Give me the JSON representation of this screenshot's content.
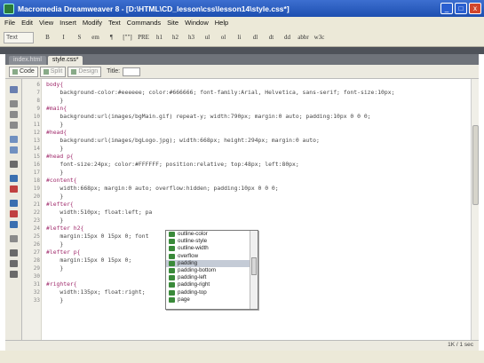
{
  "window": {
    "title": "Macromedia Dreamweaver 8 - [D:\\HTML\\CD_lesson\\css\\lesson14\\style.css*]"
  },
  "window_buttons": [
    "_",
    "□",
    "x"
  ],
  "menu": [
    "File",
    "Edit",
    "View",
    "Insert",
    "Modify",
    "Text",
    "Commands",
    "Site",
    "Window",
    "Help"
  ],
  "insert_bar": {
    "category": "Text",
    "buttons": [
      "B",
      "I",
      "S",
      "em",
      "¶",
      "[\"\"]",
      "PRE",
      "h1",
      "h2",
      "h3",
      "ul",
      "ol",
      "li",
      "dl",
      "dt",
      "dd",
      "abbr",
      "w3c"
    ]
  },
  "doc_tabs": [
    "index.html",
    "style.css*"
  ],
  "doc_toolbar": {
    "code": "Code",
    "split": "Split",
    "design": "Design",
    "title_label": "Title:"
  },
  "code_lines": [
    {
      "n": "6",
      "text": "body{",
      "kind": "sel"
    },
    {
      "n": "7",
      "text": "    background-color:#eeeeee; color:#666666; font-family:Arial, Helvetica, sans-serif; font-size:10px;",
      "kind": "prop"
    },
    {
      "n": "8",
      "text": "    }",
      "kind": "prop"
    },
    {
      "n": "9",
      "text": "#main{",
      "kind": "sel"
    },
    {
      "n": "10",
      "text": "    background:url(images/bgMain.gif) repeat-y; width:790px; margin:0 auto; padding:10px 0 0 0;",
      "kind": "prop"
    },
    {
      "n": "11",
      "text": "    }",
      "kind": "prop"
    },
    {
      "n": "12",
      "text": "#head{",
      "kind": "sel"
    },
    {
      "n": "13",
      "text": "    background:url(images/bgLogo.jpg); width:668px; height:294px; margin:0 auto;",
      "kind": "prop"
    },
    {
      "n": "14",
      "text": "    }",
      "kind": "prop"
    },
    {
      "n": "15",
      "text": "#head p{",
      "kind": "sel"
    },
    {
      "n": "16",
      "text": "    font-size:24px; color:#FFFFFF; position:relative; top:48px; left:80px;",
      "kind": "prop"
    },
    {
      "n": "17",
      "text": "    }",
      "kind": "prop"
    },
    {
      "n": "18",
      "text": "#content{",
      "kind": "sel"
    },
    {
      "n": "19",
      "text": "    width:668px; margin:0 auto; overflow:hidden; padding:10px 0 0 0;",
      "kind": "prop"
    },
    {
      "n": "20",
      "text": "    }",
      "kind": "prop"
    },
    {
      "n": "21",
      "text": "#lefter{",
      "kind": "sel"
    },
    {
      "n": "22",
      "text": "    width:510px; float:left; pa",
      "kind": "prop"
    },
    {
      "n": "23",
      "text": "    }",
      "kind": "prop"
    },
    {
      "n": "24",
      "text": "#lefter h2{",
      "kind": "sel"
    },
    {
      "n": "25",
      "text": "    margin:15px 0 15px 0; font",
      "kind": "prop"
    },
    {
      "n": "26",
      "text": "    }",
      "kind": "prop"
    },
    {
      "n": "27",
      "text": "#lefter p{",
      "kind": "sel"
    },
    {
      "n": "28",
      "text": "    margin:15px 0 15px 0;",
      "kind": "prop"
    },
    {
      "n": "29",
      "text": "    }",
      "kind": "prop"
    },
    {
      "n": "30",
      "text": "",
      "kind": "prop"
    },
    {
      "n": "31",
      "text": "#righter{",
      "kind": "sel"
    },
    {
      "n": "32",
      "text": "    width:135px; float:right;",
      "kind": "prop"
    },
    {
      "n": "33",
      "text": "    }",
      "kind": "prop"
    }
  ],
  "autocomplete": {
    "items": [
      "outline-color",
      "outline-style",
      "outline-width",
      "overflow",
      "padding",
      "padding-bottom",
      "padding-left",
      "padding-right",
      "padding-top",
      "page"
    ],
    "selected_index": 4
  },
  "status": {
    "text": "1K / 1 sec"
  }
}
